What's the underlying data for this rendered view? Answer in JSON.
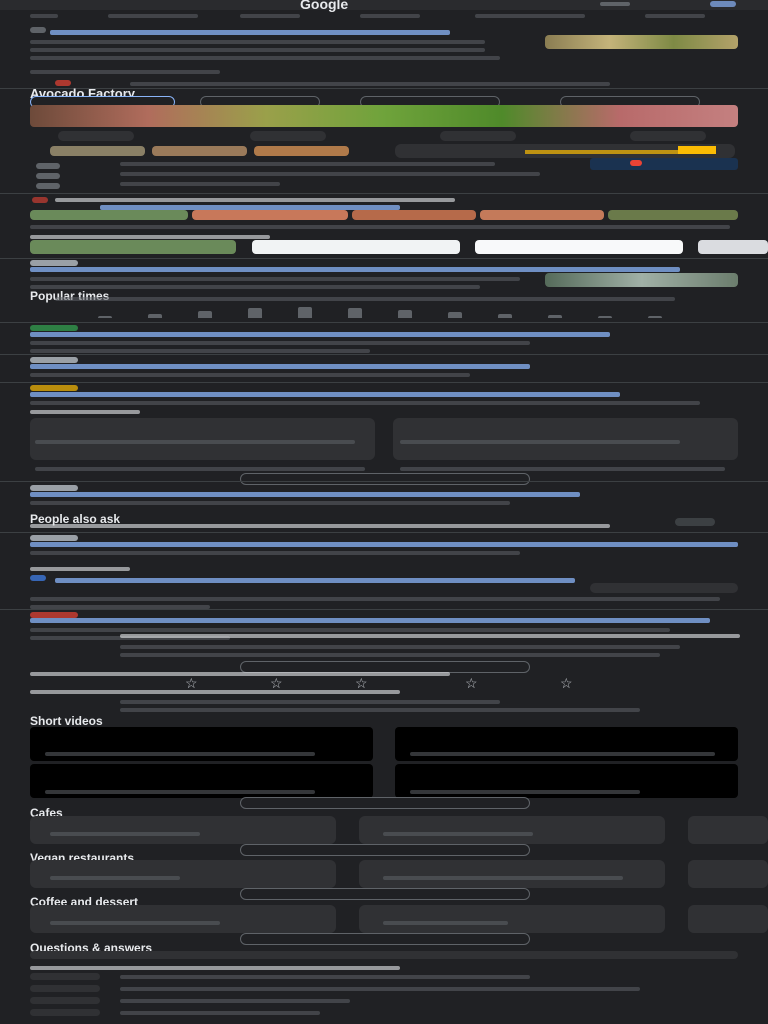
{
  "header": {
    "logo_text": "Google"
  },
  "knowledge_panel": {
    "title": "Avocado Factory"
  },
  "popular_times": {
    "title": "Popular times",
    "levels": [
      0.1,
      0.3,
      0.5,
      0.7,
      0.8,
      0.7,
      0.6,
      0.4,
      0.3,
      0.2,
      0.15,
      0.1
    ]
  },
  "sections": {
    "people_also_ask": "People also ask",
    "short_videos": "Short videos",
    "cafes": "Cafes",
    "vegan_restaurants": "Vegan restaurants",
    "coffee_and_dessert": "Coffee and dessert",
    "questions_answers": "Questions & answers"
  },
  "colors": {
    "background": "#202124",
    "link": "#8ab4f8",
    "star": "#fbbc04",
    "text": "#bdc1c6"
  }
}
